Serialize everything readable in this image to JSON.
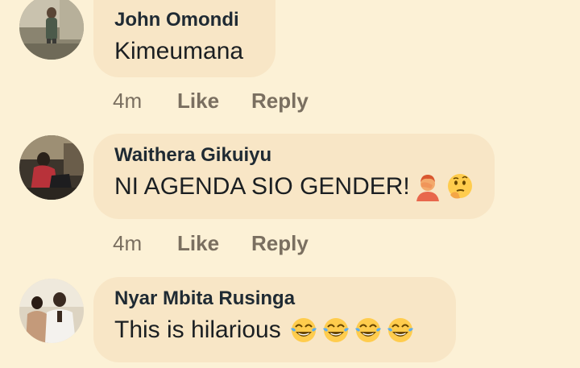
{
  "comments": [
    {
      "author": "John Omondi",
      "text": "Kimeumana",
      "time": "4m",
      "like_label": "Like",
      "reply_label": "Reply",
      "emojis": []
    },
    {
      "author": "Waithera Gikuiyu",
      "text": "NI AGENDA SIO GENDER!",
      "time": "4m",
      "like_label": "Like",
      "reply_label": "Reply",
      "emojis": [
        "person-facepalming-emoji",
        "thinking-face-emoji"
      ]
    },
    {
      "author": "Nyar Mbita Rusinga",
      "text": "This is hilarious",
      "time": "",
      "like_label": "",
      "reply_label": "",
      "emojis": [
        "tears-of-joy-emoji",
        "tears-of-joy-emoji",
        "tears-of-joy-emoji",
        "tears-of-joy-emoji"
      ]
    }
  ],
  "colors": {
    "background": "#fcf1d6",
    "bubble": "#f8e6c6",
    "author": "#1f2a33",
    "meta": "#7a6f60"
  }
}
